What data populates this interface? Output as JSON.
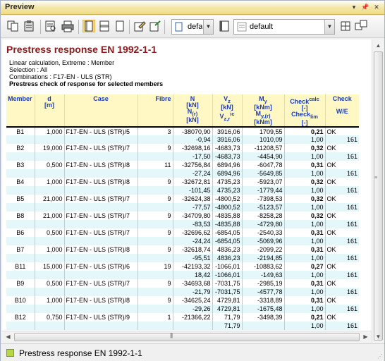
{
  "window": {
    "title": "Preview"
  },
  "toolbar": {
    "combo1_value": "defa",
    "combo2_value": "default"
  },
  "doc": {
    "title": "Prestress response EN 1992-1-1",
    "meta": [
      "Linear calculation, Extreme : Member",
      "Selection : All",
      "Combinations : F17-EN - ULS (STR)"
    ],
    "subtitle": "Prestress check of response for selected members"
  },
  "table": {
    "headers": {
      "member": "Member",
      "d": "d",
      "d_unit": "[m]",
      "case": "Case",
      "fibre": "Fibre",
      "n": "N",
      "n_unit": "[kN]",
      "n2": "N",
      "n2_sub": "(r)",
      "n2_unit": "[kN]",
      "v": "V",
      "v_sub": "z",
      "v_unit": "[kN]",
      "v2": "V",
      "v2_sub": "z,r",
      "v2_sup": "ic",
      "m": "M",
      "m_sub": "y",
      "m_unit": "[kNm]",
      "m2": "M",
      "m2_sub": "y,(r)",
      "m2_unit": "[kNm]",
      "check_calc": "Check",
      "check_calc_sup": "calc",
      "check_calc_unit": "[-]",
      "check_lim": "Check",
      "check_lim_sub": "lim",
      "check_lim_unit": "[-]",
      "check": "Check",
      "we": "W/E"
    },
    "rows": [
      {
        "member": "B1",
        "d": "1,000",
        "case": "F17-EN - ULS (STR)/5",
        "fibre": "3",
        "n1": "-38070,90",
        "n2": "-0,94",
        "v1": "3916,06",
        "v2": "3916,06",
        "m1": "1709,55",
        "m2": "1010,09",
        "c1": "0,21",
        "c2": "1,00",
        "ok": "OK",
        "we": "161"
      },
      {
        "member": "B2",
        "d": "19,000",
        "case": "F17-EN - ULS (STR)/7",
        "fibre": "9",
        "n1": "-32698,16",
        "n2": "-17,50",
        "v1": "-4683,73",
        "v2": "-4683,73",
        "m1": "-11208,57",
        "m2": "-4454,90",
        "c1": "0,32",
        "c2": "1,00",
        "ok": "OK",
        "we": "161"
      },
      {
        "member": "B3",
        "d": "0,500",
        "case": "F17-EN - ULS (STR)/8",
        "fibre": "11",
        "n1": "-32756,84",
        "n2": "-27,24",
        "v1": "6894,96",
        "v2": "6894,96",
        "m1": "-6047,78",
        "m2": "-5649,85",
        "c1": "0,31",
        "c2": "1,00",
        "ok": "OK",
        "we": "161"
      },
      {
        "member": "B4",
        "d": "1,000",
        "case": "F17-EN - ULS (STR)/8",
        "fibre": "9",
        "n1": "-32672,81",
        "n2": "-101,45",
        "v1": "4735,23",
        "v2": "4735,23",
        "m1": "-5923,07",
        "m2": "-1779,44",
        "c1": "0,32",
        "c2": "1,00",
        "ok": "OK",
        "we": "161"
      },
      {
        "member": "B5",
        "d": "21,000",
        "case": "F17-EN - ULS (STR)/7",
        "fibre": "9",
        "n1": "-32624,38",
        "n2": "-77,57",
        "v1": "-4800,52",
        "v2": "-4800,52",
        "m1": "-7398,53",
        "m2": "-5123,57",
        "c1": "0,32",
        "c2": "1,00",
        "ok": "OK",
        "we": "161"
      },
      {
        "member": "B8",
        "d": "21,000",
        "case": "F17-EN - ULS (STR)/7",
        "fibre": "9",
        "n1": "-34709,80",
        "n2": "-83,53",
        "v1": "-4835,88",
        "v2": "-4835,88",
        "m1": "-8258,28",
        "m2": "-4729,80",
        "c1": "0,32",
        "c2": "1,00",
        "ok": "OK",
        "we": "161"
      },
      {
        "member": "B6",
        "d": "0,500",
        "case": "F17-EN - ULS (STR)/7",
        "fibre": "9",
        "n1": "-32696,62",
        "n2": "-24,24",
        "v1": "-6854,05",
        "v2": "-6854,05",
        "m1": "-2540,33",
        "m2": "-5069,96",
        "c1": "0,31",
        "c2": "1,00",
        "ok": "OK",
        "we": "161"
      },
      {
        "member": "B7",
        "d": "1,000",
        "case": "F17-EN - ULS (STR)/8",
        "fibre": "9",
        "n1": "-32618,74",
        "n2": "-95,51",
        "v1": "4836,23",
        "v2": "4836,23",
        "m1": "-2099,22",
        "m2": "-2194,85",
        "c1": "0,31",
        "c2": "1,00",
        "ok": "OK",
        "we": "161"
      },
      {
        "member": "B11",
        "d": "15,000",
        "case": "F17-EN - ULS (STR)/6",
        "fibre": "19",
        "n1": "-42193,32",
        "n2": "18,42",
        "v1": "-1066,01",
        "v2": "-1066,01",
        "m1": "-10883,62",
        "m2": "-149,63",
        "c1": "0,27",
        "c2": "1,00",
        "ok": "OK",
        "we": "161"
      },
      {
        "member": "B9",
        "d": "0,500",
        "case": "F17-EN - ULS (STR)/7",
        "fibre": "9",
        "n1": "-34693,68",
        "n2": "-21,79",
        "v1": "-7031,75",
        "v2": "-7031,75",
        "m1": "-2985,19",
        "m2": "-4577,78",
        "c1": "0,31",
        "c2": "1,00",
        "ok": "OK",
        "we": "161"
      },
      {
        "member": "B10",
        "d": "1,000",
        "case": "F17-EN - ULS (STR)/8",
        "fibre": "9",
        "n1": "-34625,24",
        "n2": "-29,26",
        "v1": "4729,81",
        "v2": "4729,81",
        "m1": "-3318,89",
        "m2": "-1675,48",
        "c1": "0,31",
        "c2": "1,00",
        "ok": "OK",
        "we": "161"
      },
      {
        "member": "B12",
        "d": "0,750",
        "case": "F17-EN - ULS (STR)/9",
        "fibre": "1",
        "n1": "-21366,22",
        "n2": "",
        "v1": "71,79",
        "v2": "71,79",
        "m1": "-3498,39",
        "m2": "",
        "c1": "0,21",
        "c2": "1,00",
        "ok": "OK",
        "we": "161"
      }
    ]
  },
  "status": {
    "label": "Prestress response EN 1992-1-1"
  },
  "icons": [
    "copy-icon",
    "paste-icon",
    "print-preview-icon",
    "print-icon",
    "layout-a-icon",
    "layout-b-icon",
    "layout-c-icon",
    "edit-icon",
    "export-icon",
    "page-icon",
    "book-icon",
    "template-icon",
    "grid-icon",
    "tile-icon"
  ]
}
